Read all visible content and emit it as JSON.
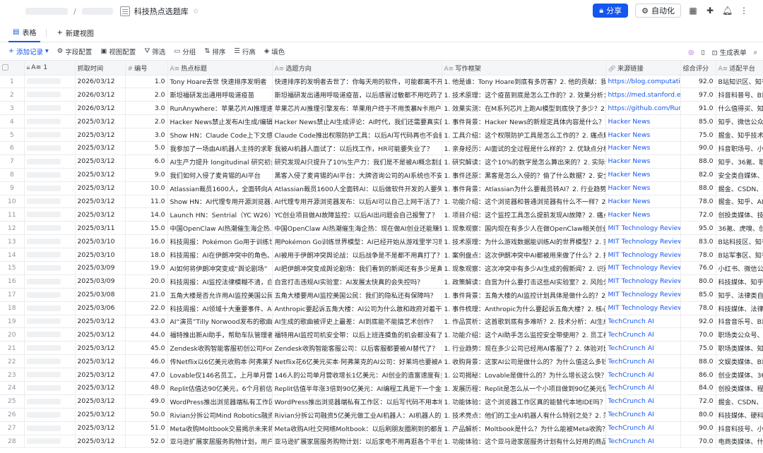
{
  "header": {
    "title": "科技热点选题库",
    "share": "分享",
    "automation": "自动化"
  },
  "tabs": [
    {
      "label": "表格"
    },
    {
      "label": "新建视图"
    }
  ],
  "toolbar": {
    "add": "添加记录",
    "field_config": "字段配置",
    "view_config": "视图配置",
    "filter": "筛选",
    "group": "分组",
    "sort": "排序",
    "row_height": "行高",
    "fill": "填色",
    "generate_form": "生成表单"
  },
  "columns": [
    "",
    "A≡ 1",
    "抓取时间",
    "编号",
    "热点标题",
    "选题方向",
    "写作框架",
    "来源链接",
    "综合评分",
    "适配平台"
  ],
  "rows": [
    [
      "1",
      "2026/03/12",
      "1.0",
      "Tony Hoare去世 快速排序发明者",
      "快速排序的发明者去世了：你每天用的软件，可能都离不开他…",
      "1. 他是谁：Tony Hoare到底有多厉害？2. 他的贡献：我们…",
      "https://blog.computatio…",
      "92.0",
      "B站知识区、知乎视频、…"
    ],
    [
      "2",
      "2026/03/12",
      "2.0",
      "斯坦福研发出通用呼吸道疫苗",
      "斯坦福研发出通用呼吸道疫苗，以后感冒过敏都不用吃药了？",
      "1. 技术原理：这个疫苗到底是怎么工作的？2. 效果分析：…",
      "https://med.stanford.ed…",
      "97.0",
      "抖音科普号、B站知识区、…"
    ],
    [
      "3",
      "2026/03/12",
      "3.0",
      "RunAnywhere：苹果芯片AI推理速…",
      "苹果芯片AI推理引擎发布：苹果用户终于不用羡慕N卡用户了？",
      "1. 效果实测：在M系列芯片上跑AI模型到底快了多少？2. 技…",
      "https://github.com/Run…",
      "91.0",
      "什么值得买、知乎、B站…"
    ],
    [
      "4",
      "2025/03/12",
      "2.0",
      "Hacker News禁止发布AI生成/编辑…",
      "Hacker News禁止AI生成评论：AI时代，我们还需要真实的人…",
      "1. 事件背景：Hacker News的新规定具体内容是什么？2. 技…",
      "Hacker News",
      "85.0",
      "知乎、微信公众号、科…"
    ],
    [
      "5",
      "2025/03/12",
      "3.0",
      "Show HN：Claude Code上下文感知…",
      "Claude Code推出权限防护工具：以后AI写代码再也不会删库…",
      "1. 工具介绍：这个权限防护工具是怎么工作的？2. 痛点解…",
      "Hacker News",
      "75.0",
      "掘金、知乎技术区、程…"
    ],
    [
      "6",
      "2025/03/12",
      "5.0",
      "我参加了一场由AI机器人主持的求职…",
      "我被AI机器人面试了：以后找工作，HR可能要失业了？",
      "1. 亲身经历：AI面试的全过程是什么样的？2. 优缺点分析：…",
      "Hacker News",
      "90.0",
      "抖音职场号、小红书、…"
    ],
    [
      "7",
      "2025/03/12",
      "6.0",
      "AI生产力提升 longitudinal 研究初步…",
      "研究发现AI只提升了10%生产力：我们是不是被AI概念割韭菜了？",
      "1. 研究解读：这个10%的数字是怎么算出来的？2. 实际体…",
      "Hacker News",
      "88.0",
      "知乎、36氪、职场类公…"
    ],
    [
      "8",
      "2025/03/12",
      "9.0",
      "我们如何入侵了麦肯锡的AI平台",
      "黑客入侵了麦肯锡的AI平台：大牌咨询公司的AI系统也不安全？",
      "1. 事件还原：黑客是怎么入侵的？偷了什么数据？2. 安全…",
      "Hacker News",
      "82.0",
      "安全类自媒体、科技媒…"
    ],
    [
      "9",
      "2025/03/12",
      "10.0",
      "Atlassian裁员1600人，全面转向AI…",
      "Atlassian裁员1600人全面转AI：以后做软件开发的人要失业了？",
      "1. 事件背景：Atlassian为什么要裁员转AI？2. 行业趋势：还…",
      "Hacker News",
      "88.0",
      "掘金、CSDN、程序员社区…"
    ],
    [
      "10",
      "2025/03/12",
      "11.0",
      "Show HN：AI代理专用开源浏览器…",
      "AI代理专用开源浏览器发布：以后AI可以自己上网干活了？",
      "1. 功能介绍：这个浏览器和普通浏览器有什么不一样？2. 技…",
      "Hacker News",
      "78.0",
      "掘金、知乎、AI类…"
    ],
    [
      "11",
      "2025/03/12",
      "14.0",
      "Launch HN：Sentrial（YC W26）…",
      "YC创业项目做AI故障监控：以后AI出问题会自己报警了？",
      "1. 项目介绍：这个监控工具怎么提前发现AI故障？2. 痛点解…",
      "Hacker News",
      "72.0",
      "创投类媒体、技术公众…"
    ],
    [
      "12",
      "2025/03/11",
      "15.0",
      "中国OpenClaw AI热潮催生海企热…",
      "中国OpenClaw AI热潮催生海企热：现在做AI创业还能赚到钱…",
      "1. 现象观察：国内现在有多少人在做OpenClaw相关创业？2. …",
      "MIT Technology Review",
      "95.0",
      "36氪、虎嗅、创业类公…"
    ],
    [
      "13",
      "2025/03/10",
      "16.0",
      "科技周报：Pokémon Go用于训练世…",
      "用Pokémon Go训练世界模型：AI已经开始从游戏里学习现实…",
      "1. 技术原理：为什么游戏数据能训练AI的世界模型？2. 实际效…",
      "MIT Technology Review",
      "83.0",
      "B站科技区、知乎、AI类…"
    ],
    [
      "14",
      "2025/03/10",
      "18.0",
      "科技周报：AI在伊朗冲突中的角色、…",
      "AI被用于伊朗冲突舆论战：以后战争是不是都不用真打了？",
      "1. 案例盘点：这次伊朗冲突中AI都被用来做了什么？2. 技术…",
      "MIT Technology Review",
      "78.0",
      "B站军事区、知乎、国际…"
    ],
    [
      "15",
      "2025/03/09",
      "19.0",
      "AI如何将伊朗冲突变成“舆论剧场”",
      "AI把伊朗冲突变成舆论剧场：我们看到的新闻还有多少是真的？",
      "1. 现象观察：这次冲突中有多少AI生成的假新闻？2. 识别难…",
      "MIT Technology Review",
      "76.0",
      "小红书、微信公众号、…"
    ],
    [
      "16",
      "2025/03/09",
      "20.0",
      "科技周报：AI监控法律模糊不清，白…",
      "白宫打击违规AI实验室：AI发展太快真的会失控吗？",
      "1. 政策解读：白宫为什么要打击这些AI实验室？2. 风险分析…",
      "MIT Technology Review",
      "80.0",
      "科技媒体、知乎、AI类…"
    ],
    [
      "17",
      "2025/03/08",
      "21.0",
      "五角大楼是否允许用AI监控美国公民…",
      "五角大楼要用AI监控美国公民：我们的隐私还有保障吗？",
      "1. 事件背景：五角大楼的AI监控计划具体是做什么的？2. 技…",
      "MIT Technology Review",
      "85.0",
      "知乎、法律类自媒体、…"
    ],
    [
      "18",
      "2025/03/06",
      "22.0",
      "科技周报：AI领域十大重要事件、A…",
      "Anthropic要起诉五角大楼：AI公司为什么敢和政府对着干？",
      "1. 事件梳理：Anthropic为什么要起诉五角大楼？2. 核心矛…",
      "MIT Technology Review",
      "78.0",
      "科技媒体、法律类公众…"
    ],
    [
      "19",
      "2025/03/12",
      "43.0",
      "AI“演员”Tilly Norwood发布的歌曲被…",
      "AI生成的歌曲被评史上最差：AI到底能不能搞艺术创作？",
      "1. 作品赏析：这首歌到底有多难听？2. 技术分析：AI生成音…",
      "TechCrunch AI",
      "92.0",
      "抖音音乐号、B站音乐区…"
    ],
    [
      "20",
      "2025/03/12",
      "44.0",
      "福特推出新AI助手，帮助车队管理者…",
      "福特用AI监控司机安全带：以后上班连摸鱼的机会都没有了？",
      "1. 功能介绍：这个AI助手怎么监控安全带使用？2. 员工视角…",
      "TechCrunch AI",
      "70.0",
      "职场类公众号、抖音、…"
    ],
    [
      "21",
      "2025/03/12",
      "45.0",
      "Zendesk收购智能客服初创公司Foret…",
      "Zendesk收购智能客服公司：以后客服都要被AI替代了？",
      "1. 行业趋势：现在多少公司已经用AI客服了？2. 体验对比：…",
      "TechCrunch AI",
      "75.0",
      "职场类媒体、知乎、Saa…"
    ],
    [
      "22",
      "2025/03/12",
      "46.0",
      "传Netflix以6亿美元收购本·阿弗莱克…",
      "Netflix花6亿美元买本·阿弗莱克的AI公司：好莱坞也要被AI颠…",
      "1. 收购背景：这家AI公司是做什么的？为什么值这么多钱？2…",
      "TechCrunch AI",
      "88.0",
      "文娱类媒体、B站影视区…"
    ],
    [
      "23",
      "2025/03/12",
      "47.0",
      "Lovable仅146名员工，上月单月营收…",
      "146人的公司单月营收增长1亿美元：AI创业的造富速度有多夸…",
      "1. 公司揭秘：Lovable是做什么的？为什么增长这么快？2. …",
      "TechCrunch AI",
      "86.0",
      "创业类媒体、36氪、虎嗅…"
    ],
    [
      "24",
      "2025/03/12",
      "48.0",
      "Replit估值达90亿美元，6个月前估…",
      "Replit估值半年涨3倍到90亿美元：AI编程工具是下一个金矿？",
      "1. 发展历程：Replit是怎么从一个小项目做到90亿美元估值…",
      "TechCrunch AI",
      "84.0",
      "创投类媒体、程序员社…"
    ],
    [
      "25",
      "2025/03/12",
      "49.0",
      "WordPress推出浏览器端私有工作区…",
      "WordPress推出浏览器端私有工作区：以后写代码不用本地装…",
      "1. 功能体验：这个浏览器工作区真的能替代本地IDE吗？2. 技…",
      "TechCrunch AI",
      "72.0",
      "掘金、CSDN、程序员公…"
    ],
    [
      "26",
      "2025/03/12",
      "50.0",
      "Rivian分拆公司Mind Robotics融资5…",
      "Rivian分拆公司融资5亿美元做工业AI机器人：AI机器人的春天…",
      "1. 技术亮点：他们的工业AI机器人有什么特别之处？2. 落地…",
      "TechCrunch AI",
      "80.0",
      "科技媒体、硬科技自媒…"
    ],
    [
      "27",
      "2025/03/12",
      "51.0",
      "Meta收购Moltbook交易揭示未来将…",
      "Meta收购AI社交网络Moltbook：以后刷朋友圈刷到的都是AI？",
      "1. 产品解析：Moltbook是什么？为什么能被Meta收购？2. …",
      "TechCrunch AI",
      "90.0",
      "抖音科技号、小红书、…"
    ],
    [
      "28",
      "2025/03/12",
      "52.0",
      "亚马逊扩展家居服务购物计划，用户…",
      "亚马逊扩展家居服务购物计划：以后家电不用再逛各个平台了？",
      "1. 功能体验：这个亚马逊家居服务计划有什么好用的商品…",
      "TechCrunch AI",
      "70.0",
      "电商类媒体、什么值得…"
    ]
  ]
}
